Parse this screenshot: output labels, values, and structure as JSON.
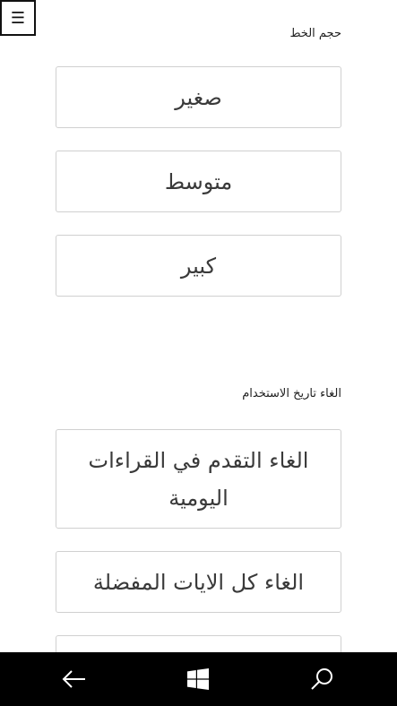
{
  "header": {
    "menu_icon": "hamburger-menu-icon",
    "menu_glyph": "☰"
  },
  "font_size": {
    "label": "حجم الخط",
    "options": [
      "صغير",
      "متوسط",
      "كبير"
    ]
  },
  "history": {
    "label": "الغاء تاريخ الاستخدام",
    "options": [
      "الغاء التقدم في القراءات اليومية",
      "الغاء كل الايات المفضلة"
    ]
  },
  "taskbar": {
    "back_icon": "back-arrow-icon",
    "start_icon": "windows-logo-icon",
    "search_icon": "search-icon"
  },
  "colors": {
    "taskbar_bg": "#000000",
    "button_border": "#d0d0d0",
    "text": "#3a3a3a"
  }
}
